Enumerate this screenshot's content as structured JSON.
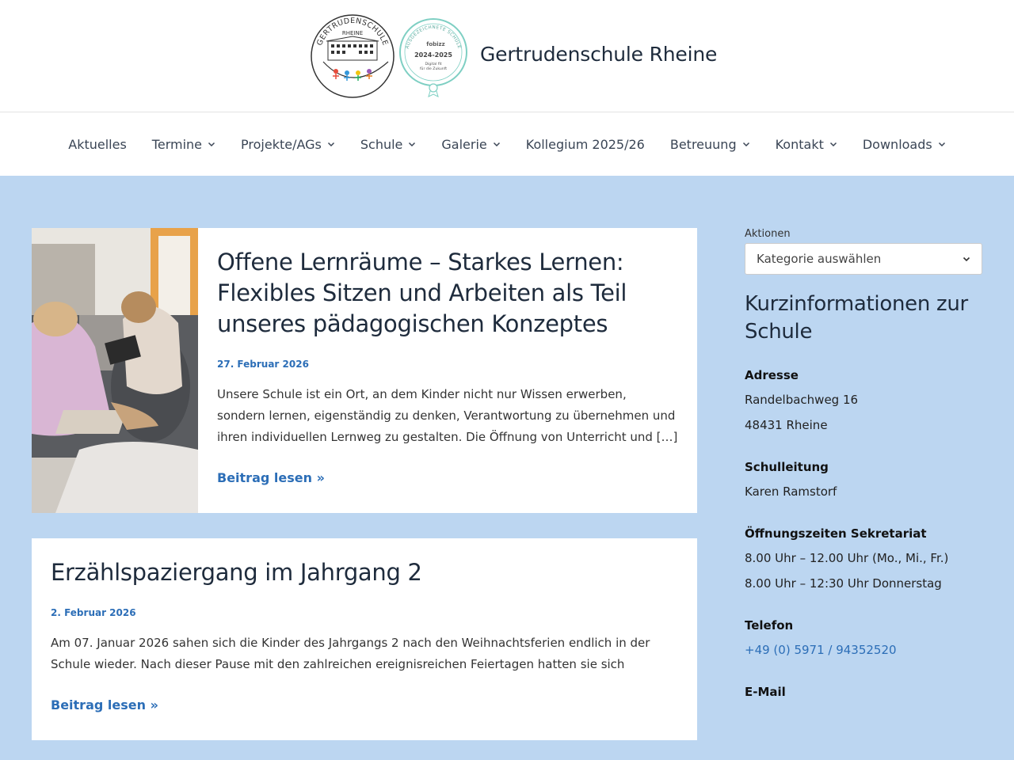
{
  "header": {
    "site_title": "Gertrudenschule Rheine",
    "logo_text_top": "GERTRUDENSCHULE",
    "logo_text_sub": "RHEINE",
    "badge_text_top": "AUSGEZEICHNETE SCHULE",
    "badge_brand": "fobizz",
    "badge_year": "2024-2025",
    "badge_sub1": "Digital fit",
    "badge_sub2": "für die Zukunft"
  },
  "nav": {
    "items": [
      {
        "label": "Aktuelles"
      },
      {
        "label": "Termine"
      },
      {
        "label": "Projekte/AGs"
      },
      {
        "label": "Schule"
      },
      {
        "label": "Galerie"
      },
      {
        "label": "Kollegium 2025/26"
      },
      {
        "label": "Betreuung"
      },
      {
        "label": "Kontakt"
      },
      {
        "label": "Downloads"
      }
    ]
  },
  "posts": [
    {
      "title": "Offene Lernräume – Starkes Lernen: Flexibles Sitzen und Arbeiten als Teil unseres pädagogischen Konzeptes",
      "date": "27. Februar 2026",
      "excerpt": "Unsere Schule ist ein Ort, an dem Kinder nicht nur Wissen erwerben, sondern lernen, eigenständig zu denken, Verantwortung zu übernehmen und ihren individuellen Lernweg zu gestalten. Die Öffnung von Unterricht und […]",
      "read_more": "Beitrag lesen »"
    },
    {
      "title": "Erzählspaziergang im Jahrgang 2",
      "date": "2. Februar 2026",
      "excerpt": "Am 07. Januar 2026 sahen sich die Kinder des Jahrgangs 2 nach den Weihnachtsferien endlich in der Schule wieder. Nach dieser Pause mit den zahlreichen ereignisreichen Feiertagen hatten sie sich",
      "read_more": "Beitrag lesen »"
    }
  ],
  "sidebar": {
    "category_label": "Aktionen",
    "category_select": "Kategorie auswählen",
    "heading": "Kurzinformationen zur Schule",
    "address_title": "Adresse",
    "address_line1": "Randelbachweg 16",
    "address_line2": "48431 Rheine",
    "head_title": "Schulleitung",
    "head_name": "Karen Ramstorf",
    "hours_title": "Öffnungszeiten Sekretariat",
    "hours_line1": "8.00 Uhr – 12.00 Uhr (Mo., Mi., Fr.)",
    "hours_line2": "8.00 Uhr – 12:30 Uhr Donnerstag",
    "phone_title": "Telefon",
    "phone": "+49 (0) 5971 / 94352520",
    "email_title": "E-Mail"
  }
}
